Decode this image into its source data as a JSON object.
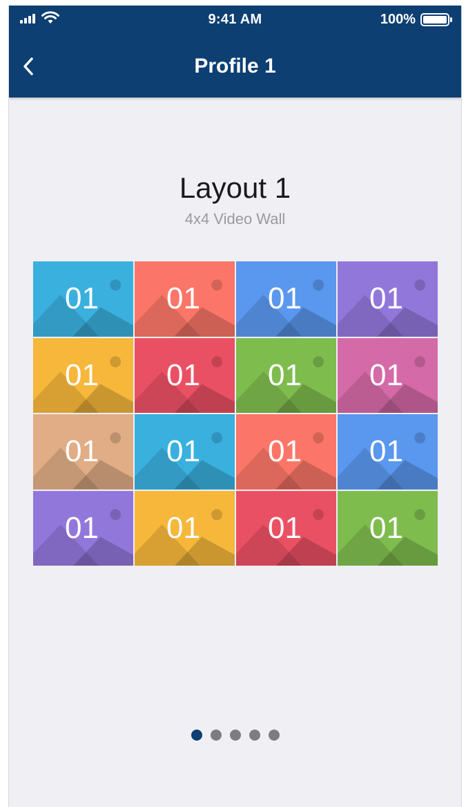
{
  "status_bar": {
    "time": "9:41 AM",
    "battery": "100%"
  },
  "nav": {
    "title": "Profile 1",
    "back_icon": "chevron-left-icon"
  },
  "layout": {
    "title": "Layout 1",
    "subtitle": "4x4 Video Wall"
  },
  "tiles": [
    {
      "label": "01",
      "color": "#3ab0df"
    },
    {
      "label": "01",
      "color": "#fb7668"
    },
    {
      "label": "01",
      "color": "#5a97ee"
    },
    {
      "label": "01",
      "color": "#9277db"
    },
    {
      "label": "01",
      "color": "#f6b73b"
    },
    {
      "label": "01",
      "color": "#ea5063"
    },
    {
      "label": "01",
      "color": "#7fbc4e"
    },
    {
      "label": "01",
      "color": "#d56aa8"
    },
    {
      "label": "01",
      "color": "#e0ad86"
    },
    {
      "label": "01",
      "color": "#3ab0df"
    },
    {
      "label": "01",
      "color": "#fb7668"
    },
    {
      "label": "01",
      "color": "#5a97ee"
    },
    {
      "label": "01",
      "color": "#9277db"
    },
    {
      "label": "01",
      "color": "#f6b73b"
    },
    {
      "label": "01",
      "color": "#ea5063"
    },
    {
      "label": "01",
      "color": "#7fbc4e"
    }
  ],
  "pager": {
    "pages": 5,
    "active_index": 0,
    "active_color": "#0d3f72",
    "inactive_color": "#7d7d80"
  },
  "colors": {
    "header_bg": "#0d3f72",
    "page_bg": "#efeff4"
  }
}
